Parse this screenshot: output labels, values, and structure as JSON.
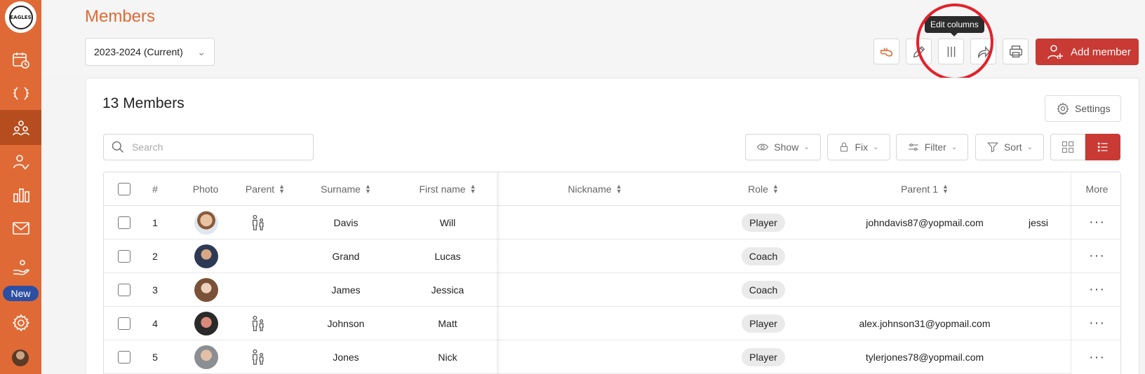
{
  "app": {
    "page_title": "Members",
    "logo_text": "EAGLES",
    "accent_color": "#e06a35",
    "add_color": "#c83a33"
  },
  "sidebar": {
    "items": [
      {
        "name": "calendar-clock-icon"
      },
      {
        "name": "laurel-icon"
      },
      {
        "name": "members-icon",
        "active": true
      },
      {
        "name": "user-check-icon"
      },
      {
        "name": "stats-icon"
      },
      {
        "name": "mail-icon"
      },
      {
        "name": "donate-hand-icon"
      },
      {
        "name": "settings-gear-icon"
      }
    ],
    "new_badge": "New"
  },
  "toolbar": {
    "season": "2023-2024 (Current)",
    "tooltip": "Edit columns",
    "add_member": "Add member"
  },
  "panel": {
    "count_title": "13 Members",
    "settings_label": "Settings",
    "search_placeholder": "Search",
    "show_label": "Show",
    "fix_label": "Fix",
    "filter_label": "Filter",
    "sort_label": "Sort"
  },
  "table": {
    "headers": {
      "number": "#",
      "photo": "Photo",
      "parent": "Parent",
      "surname": "Surname",
      "first_name": "First name",
      "nickname": "Nickname",
      "role": "Role",
      "parent1": "Parent 1",
      "more": "More"
    },
    "rows": [
      {
        "num": "1",
        "surname": "Davis",
        "first": "Will",
        "role": "Player",
        "parent1": "johndavis87@yopmail.com",
        "extra": "jessi",
        "has_parent": true
      },
      {
        "num": "2",
        "surname": "Grand",
        "first": "Lucas",
        "role": "Coach",
        "parent1": "",
        "extra": "",
        "has_parent": false
      },
      {
        "num": "3",
        "surname": "James",
        "first": "Jessica",
        "role": "Coach",
        "parent1": "",
        "extra": "",
        "has_parent": false
      },
      {
        "num": "4",
        "surname": "Johnson",
        "first": "Matt",
        "role": "Player",
        "parent1": "alex.johnson31@yopmail.com",
        "extra": "",
        "has_parent": true
      },
      {
        "num": "5",
        "surname": "Jones",
        "first": "Nick",
        "role": "Player",
        "parent1": "tylerjones78@yopmail.com",
        "extra": "",
        "has_parent": true
      }
    ],
    "more_glyph": "···"
  }
}
